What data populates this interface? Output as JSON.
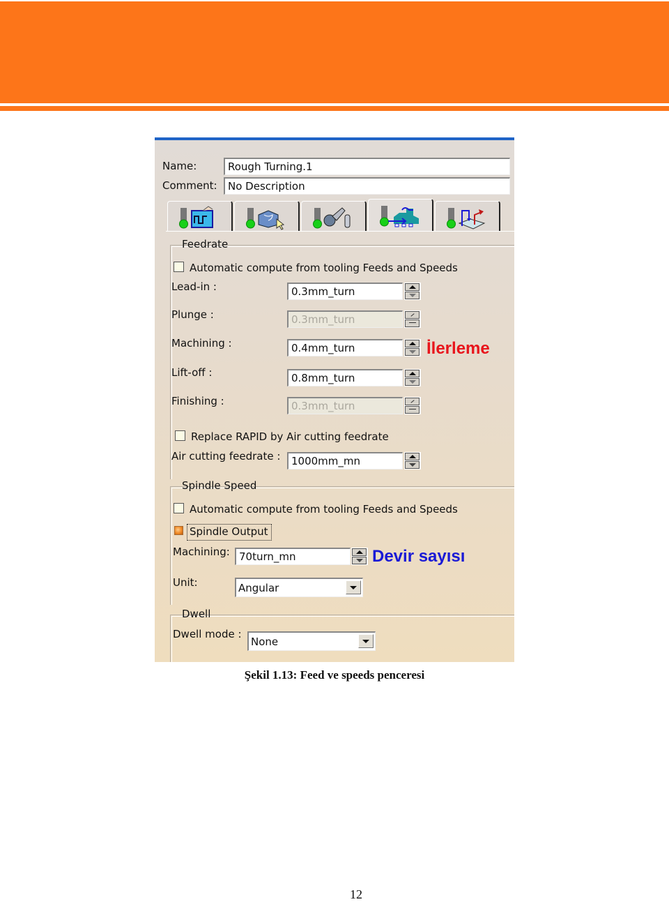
{
  "header": {
    "accent_color": "#fd7519"
  },
  "dialog": {
    "name_label": "Name:",
    "name_value": "Rough Turning.1",
    "comment_label": "Comment:",
    "comment_value": "No Description",
    "tabs": [
      {
        "icon": "strategy-icon",
        "active": false
      },
      {
        "icon": "geometry-icon",
        "active": false
      },
      {
        "icon": "tool-icon",
        "active": false
      },
      {
        "icon": "feeds-speeds-icon",
        "active": true
      },
      {
        "icon": "macros-icon",
        "active": false
      }
    ],
    "feedrate": {
      "title": "Feedrate",
      "auto_compute_label": "Automatic compute from tooling Feeds and Speeds",
      "auto_compute_checked": false,
      "fields": [
        {
          "label": "Lead-in :",
          "value": "0.3mm_turn",
          "enabled": true
        },
        {
          "label": "Plunge :",
          "value": "0.3mm_turn",
          "enabled": false
        },
        {
          "label": "Machining :",
          "value": "0.4mm_turn",
          "enabled": true
        },
        {
          "label": "Lift-off :",
          "value": "0.8mm_turn",
          "enabled": true
        },
        {
          "label": "Finishing :",
          "value": "0.3mm_turn",
          "enabled": false
        }
      ],
      "replace_rapid_label": "Replace RAPID by Air cutting feedrate",
      "replace_rapid_checked": false,
      "air_cutting_label": "Air cutting feedrate :",
      "air_cutting_value": "1000mm_mn"
    },
    "spindle": {
      "title": "Spindle Speed",
      "auto_compute_label": "Automatic compute from tooling Feeds and Speeds",
      "auto_compute_checked": false,
      "spindle_output_label": "Spindle Output",
      "spindle_output_checked": true,
      "machining_label": "Machining:",
      "machining_value": "70turn_mn",
      "unit_label": "Unit:",
      "unit_value": "Angular"
    },
    "dwell": {
      "title": "Dwell",
      "mode_label": "Dwell mode :",
      "mode_value": "None"
    }
  },
  "annotations": {
    "feed": "İlerleme",
    "feed_color": "#e8151c",
    "spindle": "Devir sayısı",
    "spindle_color": "#1a1ad6"
  },
  "caption": "Şekil 1.13: Feed ve speeds penceresi",
  "page_number": "12"
}
